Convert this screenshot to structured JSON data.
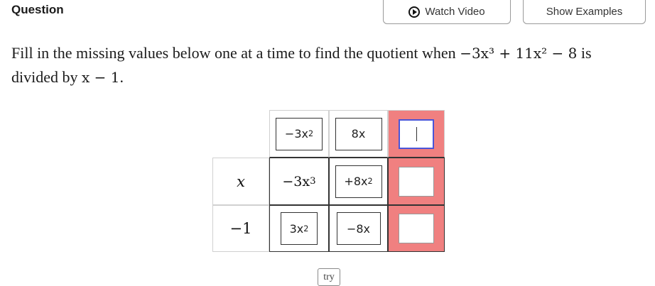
{
  "header": {
    "title": "Question",
    "watch_video_label": "Watch Video",
    "show_examples_label": "Show Examples"
  },
  "prompt": {
    "text_before": "Fill in the missing values below one at a time to find the quotient when",
    "dividend_expr": "−3x³ + 11x² − 8",
    "text_middle": "is divided by",
    "divisor_expr": "x − 1",
    "text_after": "."
  },
  "table": {
    "top_row": {
      "cell1": {
        "base": "−3x",
        "exp": "2"
      },
      "cell2": "8x",
      "cell3_value": ""
    },
    "row_x": {
      "label": "x",
      "cell1": {
        "base": "−3x",
        "exp": "3"
      },
      "cell2": {
        "base": "+8x",
        "exp": "2"
      },
      "cell3_value": ""
    },
    "row_neg1": {
      "label": "−1",
      "cell1": {
        "base": "3x",
        "exp": "2"
      },
      "cell2": "−8x",
      "cell3_value": ""
    }
  },
  "try_label": "try",
  "colors": {
    "highlight_column": "#f08080",
    "focus_border": "#4a55d8"
  }
}
